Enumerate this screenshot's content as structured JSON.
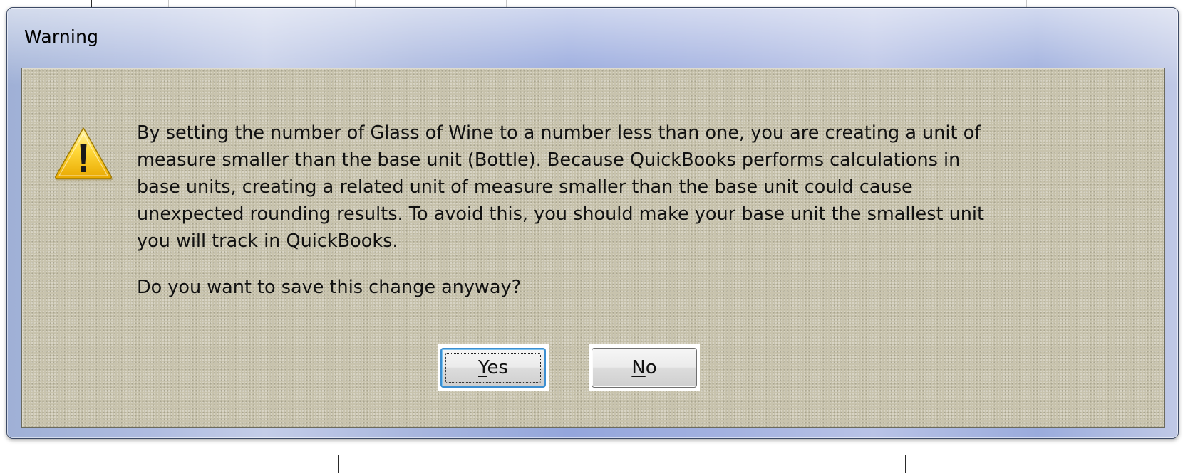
{
  "window": {
    "title": "Warning"
  },
  "message": {
    "icon": "warning-icon",
    "lines": [
      "By setting the number of Glass of Wine to a number less than one, you are creating a unit of",
      "measure smaller than the base unit (Bottle). Because QuickBooks performs calculations in",
      "base units, creating a related unit of measure smaller than the base unit could cause",
      "unexpected rounding results. To avoid this, you should make your base unit the smallest unit",
      "you will track in QuickBooks."
    ],
    "question": "Do you want to save this change anyway?"
  },
  "buttons": {
    "yes": {
      "mnemonic": "Y",
      "rest": "es"
    },
    "no": {
      "mnemonic": "N",
      "rest": "o"
    }
  },
  "colors": {
    "client_background": "#c8c3ad",
    "title_bar": "#a8b6de",
    "focus_border": "#3c8fd1"
  }
}
